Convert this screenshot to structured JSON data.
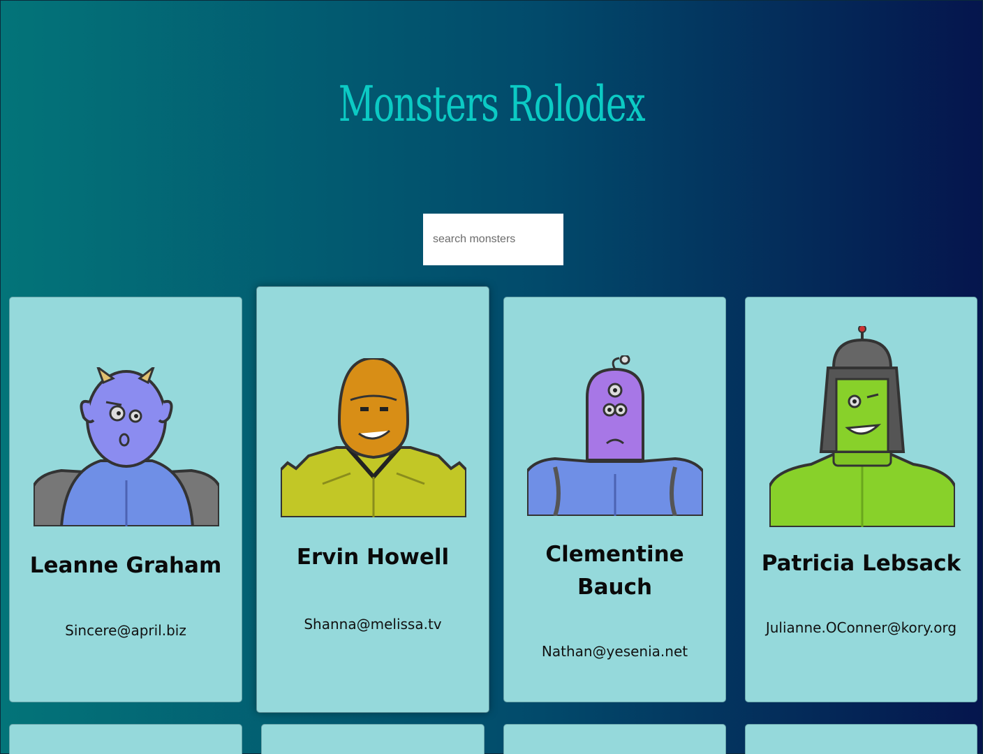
{
  "app": {
    "title": "Monsters Rolodex"
  },
  "search": {
    "placeholder": "search monsters",
    "value": ""
  },
  "monsters": [
    {
      "name": "Leanne Graham",
      "email": "Sincere@april.biz",
      "color": "#8b8cf0"
    },
    {
      "name": "Ervin Howell",
      "email": "Shanna@melissa.tv",
      "color": "#d88e16"
    },
    {
      "name": "Clementine Bauch",
      "email": "Nathan@yesenia.net",
      "color": "#a777e6"
    },
    {
      "name": "Patricia Lebsack",
      "email": "Julianne.OConner@kory.org",
      "color": "#88d12a"
    }
  ],
  "colors": {
    "accent": "#0ccac4",
    "card": "#95d9db"
  }
}
